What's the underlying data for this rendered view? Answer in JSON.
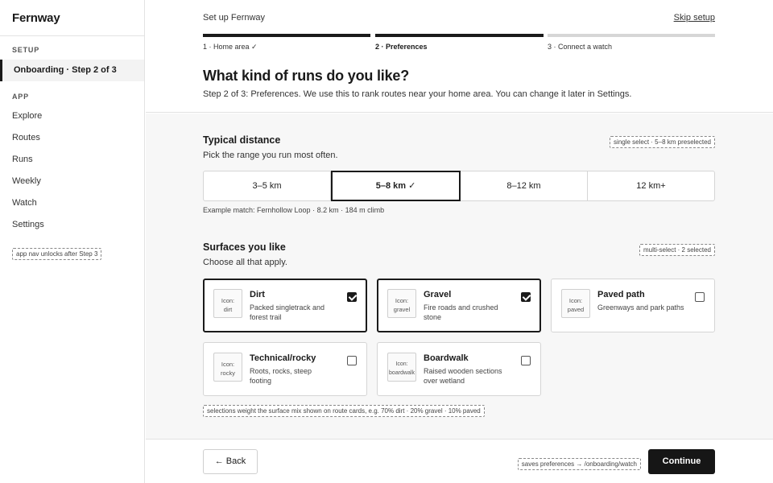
{
  "app": {
    "brand": "Fernway"
  },
  "sidebar": {
    "setup_label": "SETUP",
    "active_item": "Onboarding · Step 2 of 3",
    "app_label": "APP",
    "items": [
      {
        "label": "Explore"
      },
      {
        "label": "Routes"
      },
      {
        "label": "Runs"
      },
      {
        "label": "Weekly"
      },
      {
        "label": "Watch"
      },
      {
        "label": "Settings"
      }
    ],
    "note": "app nav unlocks after Step 3"
  },
  "header": {
    "setup_label": "Set up Fernway",
    "skip_label": "Skip setup",
    "steps": [
      {
        "label": "1 · Home area ✓",
        "state": "done"
      },
      {
        "label": "2 · Preferences",
        "state": "current"
      },
      {
        "label": "3 · Connect a watch",
        "state": "todo"
      }
    ],
    "title": "What kind of runs do you like?",
    "subtitle": "Step 2 of 3: Preferences. We use this to rank routes near your home area. You can change it later in Settings."
  },
  "distance": {
    "title": "Typical distance",
    "subtitle": "Pick the range you run most often.",
    "note": "single select · 5–8 km preselected",
    "options": [
      {
        "label": "3–5 km",
        "selected": false
      },
      {
        "label": "5–8 km  ✓",
        "selected": true
      },
      {
        "label": "8–12 km",
        "selected": false
      },
      {
        "label": "12 km+",
        "selected": false
      }
    ],
    "example": "Example match: Fernhollow Loop · 8.2 km · 184 m climb"
  },
  "surfaces": {
    "title": "Surfaces you like",
    "subtitle": "Choose all that apply.",
    "note": "multi-select · 2 selected",
    "cards": [
      {
        "icon_top": "Icon:",
        "icon_name": "dirt",
        "title": "Dirt",
        "desc": "Packed singletrack and forest trail",
        "checked": true
      },
      {
        "icon_top": "Icon:",
        "icon_name": "gravel",
        "title": "Gravel",
        "desc": "Fire roads and crushed stone",
        "checked": true
      },
      {
        "icon_top": "Icon:",
        "icon_name": "paved",
        "title": "Paved path",
        "desc": "Greenways and park paths",
        "checked": false
      },
      {
        "icon_top": "Icon:",
        "icon_name": "rocky",
        "title": "Technical/rocky",
        "desc": "Roots, rocks, steep footing",
        "checked": false
      },
      {
        "icon_top": "Icon:",
        "icon_name": "boardwalk",
        "title": "Boardwalk",
        "desc": "Raised wooden sections over wetland",
        "checked": false
      }
    ],
    "footnote": "selections weight the surface mix shown on route cards, e.g. 70% dirt · 20% gravel · 10% paved"
  },
  "footer": {
    "back_label": "← Back",
    "note": "saves preferences → /onboarding/watch",
    "continue_label": "Continue"
  },
  "colors": {
    "accent": "#161616",
    "progress_done": "#1a1a1a",
    "progress_todo": "#d6d6d6"
  }
}
